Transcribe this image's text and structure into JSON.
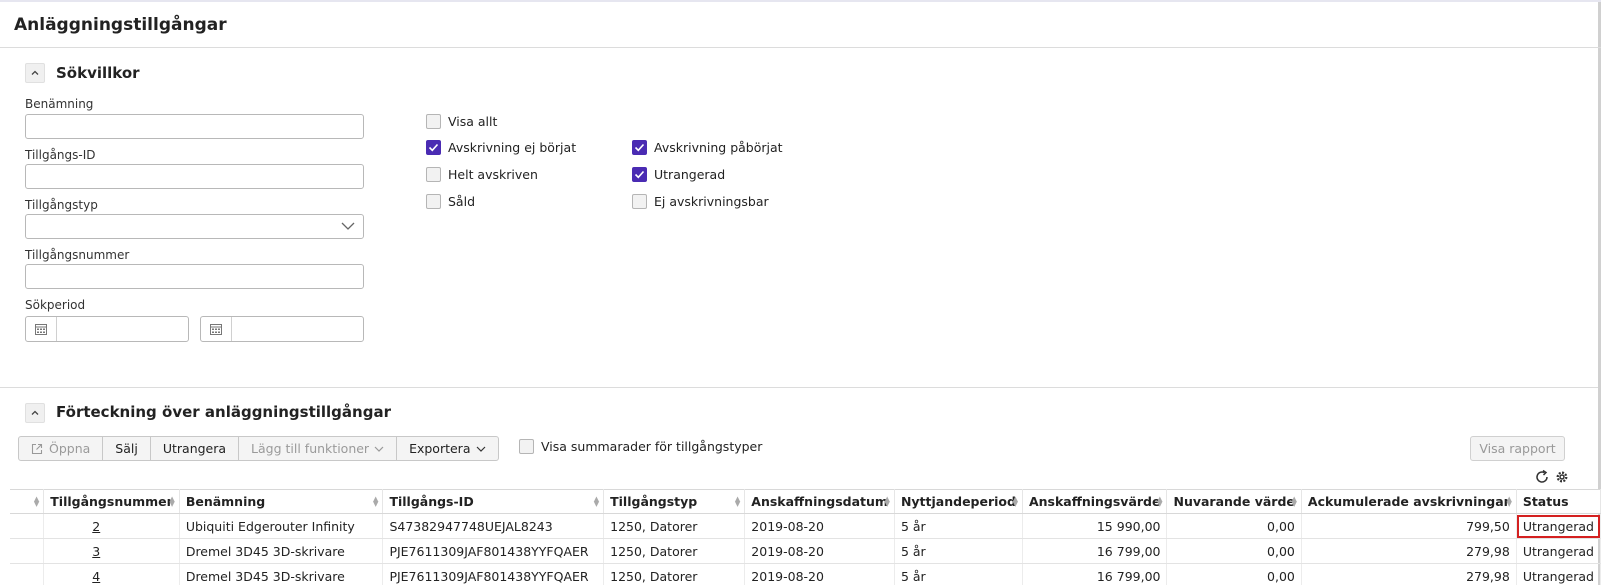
{
  "page": {
    "title": "Anläggningstillgångar"
  },
  "search": {
    "section_title": "Sökvillkor",
    "toggle_icon": "chevron-up-icon",
    "fields": {
      "benamning_label": "Benämning",
      "benamning_value": "",
      "tillgangs_id_label": "Tillgångs-ID",
      "tillgangs_id_value": "",
      "tillgangstyp_label": "Tillgångstyp",
      "tillgangstyp_value": "",
      "tillgangsnummer_label": "Tillgångsnummer",
      "tillgangsnummer_value": "",
      "sokperiod_label": "Sökperiod",
      "sokperiod_from": "",
      "sokperiod_to": ""
    },
    "checkboxes": [
      {
        "label": "Visa allt",
        "checked": false
      },
      {
        "label": "Avskrivning ej börjat",
        "checked": true
      },
      {
        "label": "Avskrivning påbörjat",
        "checked": true
      },
      {
        "label": "Helt avskriven",
        "checked": false
      },
      {
        "label": "Utrangerad",
        "checked": true
      },
      {
        "label": "Såld",
        "checked": false
      },
      {
        "label": "Ej avskrivningsbar",
        "checked": false
      }
    ]
  },
  "list": {
    "section_title": "Förteckning över anläggningstillgångar",
    "toolbar": {
      "oppna": "Öppna",
      "salj": "Sälj",
      "utrangera": "Utrangera",
      "lagg_till": "Lägg till funktioner",
      "exportera": "Exportera"
    },
    "summary_checkbox": {
      "label": "Visa summarader för tillgångstyper",
      "checked": false
    },
    "visa_rapport": "Visa rapport",
    "columns": [
      "Tillgångsnummer",
      "Benämning",
      "Tillgångs-ID",
      "Tillgångstyp",
      "Anskaffningsdatum",
      "Nyttjandeperiod",
      "Anskaffningsvärde",
      "Nuvarande värde",
      "Ackumulerade avskrivningar",
      "Status"
    ],
    "rows": [
      [
        "2",
        "Ubiquiti Edgerouter Infinity",
        "S47382947748UEJAL8243",
        "1250, Datorer",
        "2019-08-20",
        "5 år",
        "15 990,00",
        "0,00",
        "799,50",
        "Utrangerad"
      ],
      [
        "3",
        "Dremel 3D45 3D-skrivare",
        "PJE7611309JAF801438YYFQAER",
        "1250, Datorer",
        "2019-08-20",
        "5 år",
        "16 799,00",
        "0,00",
        "279,98",
        "Utrangerad"
      ],
      [
        "4",
        "Dremel 3D45 3D-skrivare",
        "PJE7611309JAF801438YYFQAER",
        "1250, Datorer",
        "2019-08-20",
        "5 år",
        "16 799,00",
        "0,00",
        "279,98",
        "Utrangerad"
      ]
    ],
    "highlighted_status_color": "#d42020"
  },
  "colors": {
    "accent": "#4a2bb3"
  }
}
